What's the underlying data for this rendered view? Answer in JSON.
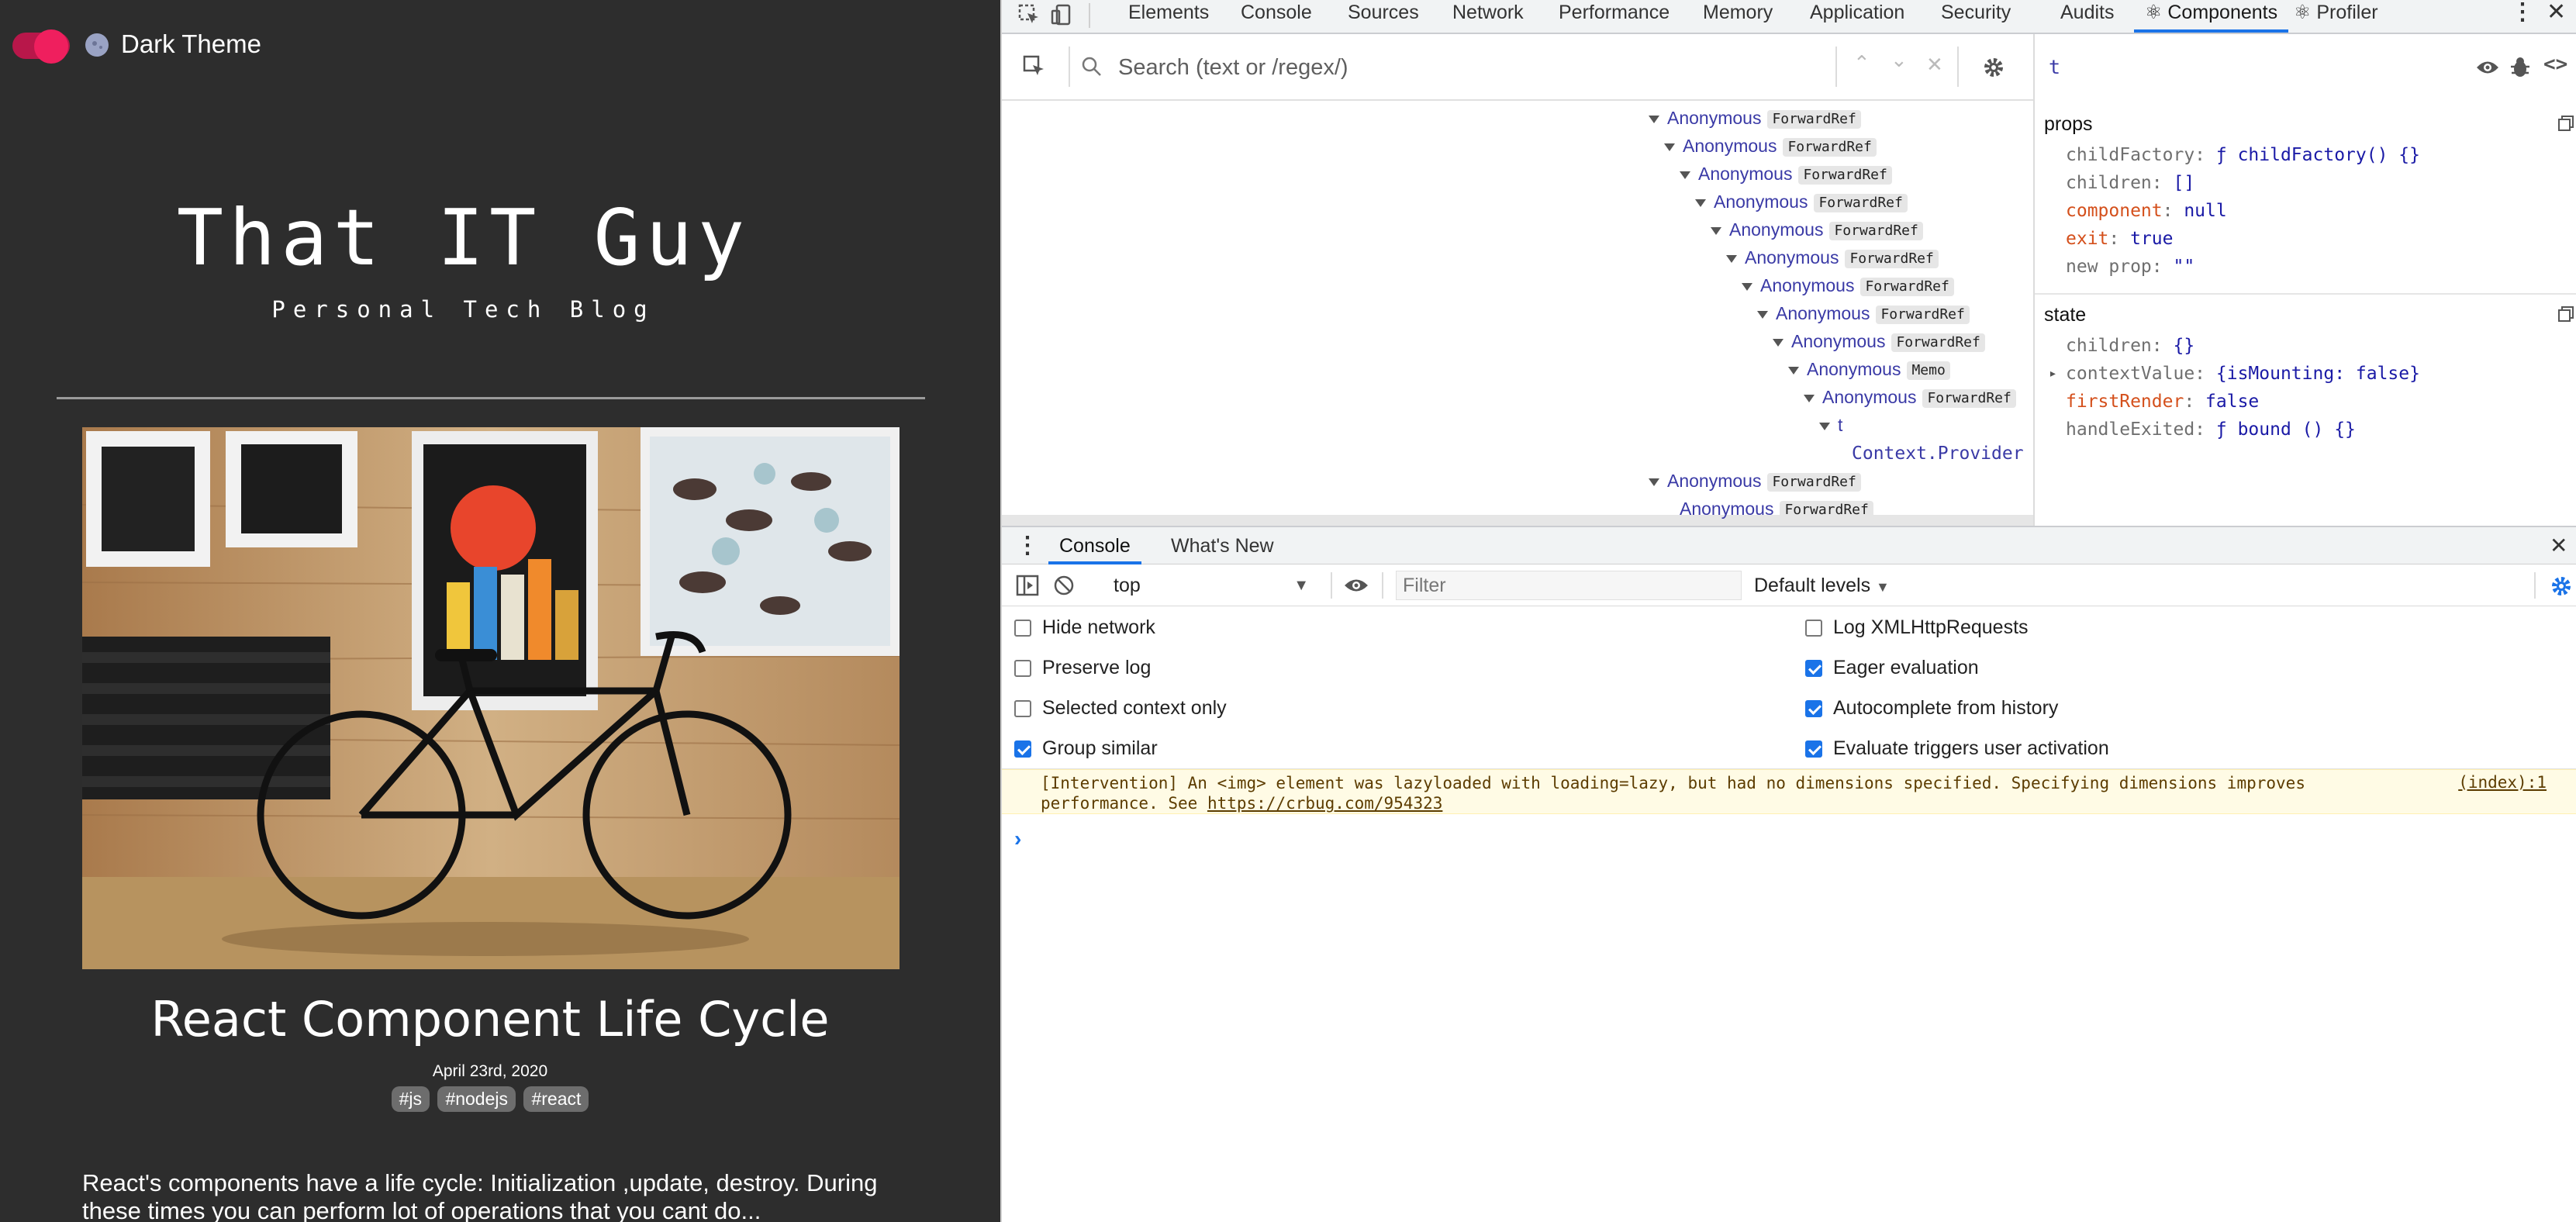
{
  "blog": {
    "theme_label": "Dark Theme",
    "title": "That IT Guy",
    "subtitle": "Personal Tech Blog",
    "post": {
      "title": "React Component Life Cycle",
      "date": "April 23rd, 2020",
      "tags": [
        "#js",
        "#nodejs",
        "#react"
      ],
      "excerpt": "React's components have a life cycle: Initialization ,update, destroy. During these times you can perform lot of operations that you cant do..."
    }
  },
  "devtools": {
    "tabs": [
      "Elements",
      "Console",
      "Sources",
      "Network",
      "Performance",
      "Memory",
      "Application",
      "Security",
      "Audits",
      "⚛ Components",
      "⚛ Profiler"
    ],
    "active_tab": "⚛ Components",
    "search_placeholder": "Search (text or /regex/)",
    "tree": [
      {
        "name": "Anonymous",
        "badge": "ForwardRef"
      },
      {
        "name": "Anonymous",
        "badge": "ForwardRef"
      },
      {
        "name": "Anonymous",
        "badge": "ForwardRef"
      },
      {
        "name": "Anonymous",
        "badge": "ForwardRef"
      },
      {
        "name": "Anonymous",
        "badge": "ForwardRef"
      },
      {
        "name": "Anonymous",
        "badge": "ForwardRef"
      },
      {
        "name": "Anonymous",
        "badge": "ForwardRef"
      },
      {
        "name": "Anonymous",
        "badge": "ForwardRef"
      },
      {
        "name": "Anonymous",
        "badge": "ForwardRef"
      },
      {
        "name": "Anonymous",
        "badge": "Memo"
      },
      {
        "name": "Anonymous",
        "badge": "ForwardRef"
      },
      {
        "name": "t",
        "badge": ""
      },
      {
        "name": "Context.Provider",
        "badge": ""
      },
      {
        "name": "Anonymous",
        "badge": "ForwardRef"
      },
      {
        "name": "Anonymous",
        "badge": "ForwardRef"
      }
    ],
    "inspector": {
      "selected_name": "t",
      "props_heading": "props",
      "props": [
        {
          "key": "childFactory",
          "value": "ƒ childFactory() {}",
          "highlight": false
        },
        {
          "key": "children",
          "value": "[]",
          "highlight": false
        },
        {
          "key": "component",
          "value": "null",
          "highlight": true
        },
        {
          "key": "exit",
          "value": "true",
          "highlight": true
        },
        {
          "key": "new prop",
          "value": "\"\"",
          "highlight": false
        }
      ],
      "state_heading": "state",
      "state": [
        {
          "key": "children",
          "value": "{}",
          "highlight": false
        },
        {
          "key": "contextValue",
          "value": "{isMounting: false}",
          "highlight": false
        },
        {
          "key": "firstRender",
          "value": "false",
          "highlight": true
        },
        {
          "key": "handleExited",
          "value": "ƒ bound () {}",
          "highlight": false
        }
      ]
    },
    "drawer": {
      "tabs": [
        "Console",
        "What's New"
      ],
      "context": "top",
      "filter_placeholder": "Filter",
      "levels": "Default levels",
      "settings_left": [
        {
          "label": "Hide network",
          "checked": false
        },
        {
          "label": "Preserve log",
          "checked": false
        },
        {
          "label": "Selected context only",
          "checked": false
        },
        {
          "label": "Group similar",
          "checked": true
        }
      ],
      "settings_right": [
        {
          "label": "Log XMLHttpRequests",
          "checked": false
        },
        {
          "label": "Eager evaluation",
          "checked": true
        },
        {
          "label": "Autocomplete from history",
          "checked": true
        },
        {
          "label": "Evaluate triggers user activation",
          "checked": true
        }
      ],
      "warning": {
        "text": "[Intervention] An <img> element was lazyloaded with loading=lazy, but had no dimensions specified. Specifying dimensions improves performance. See ",
        "link": "https://crbug.com/954323",
        "source": "(index):1"
      },
      "prompt": "›"
    },
    "colors": {
      "accent": "#1a73e8",
      "component_name": "#3a3aa6",
      "prop_highlight": "#d4501c"
    }
  }
}
